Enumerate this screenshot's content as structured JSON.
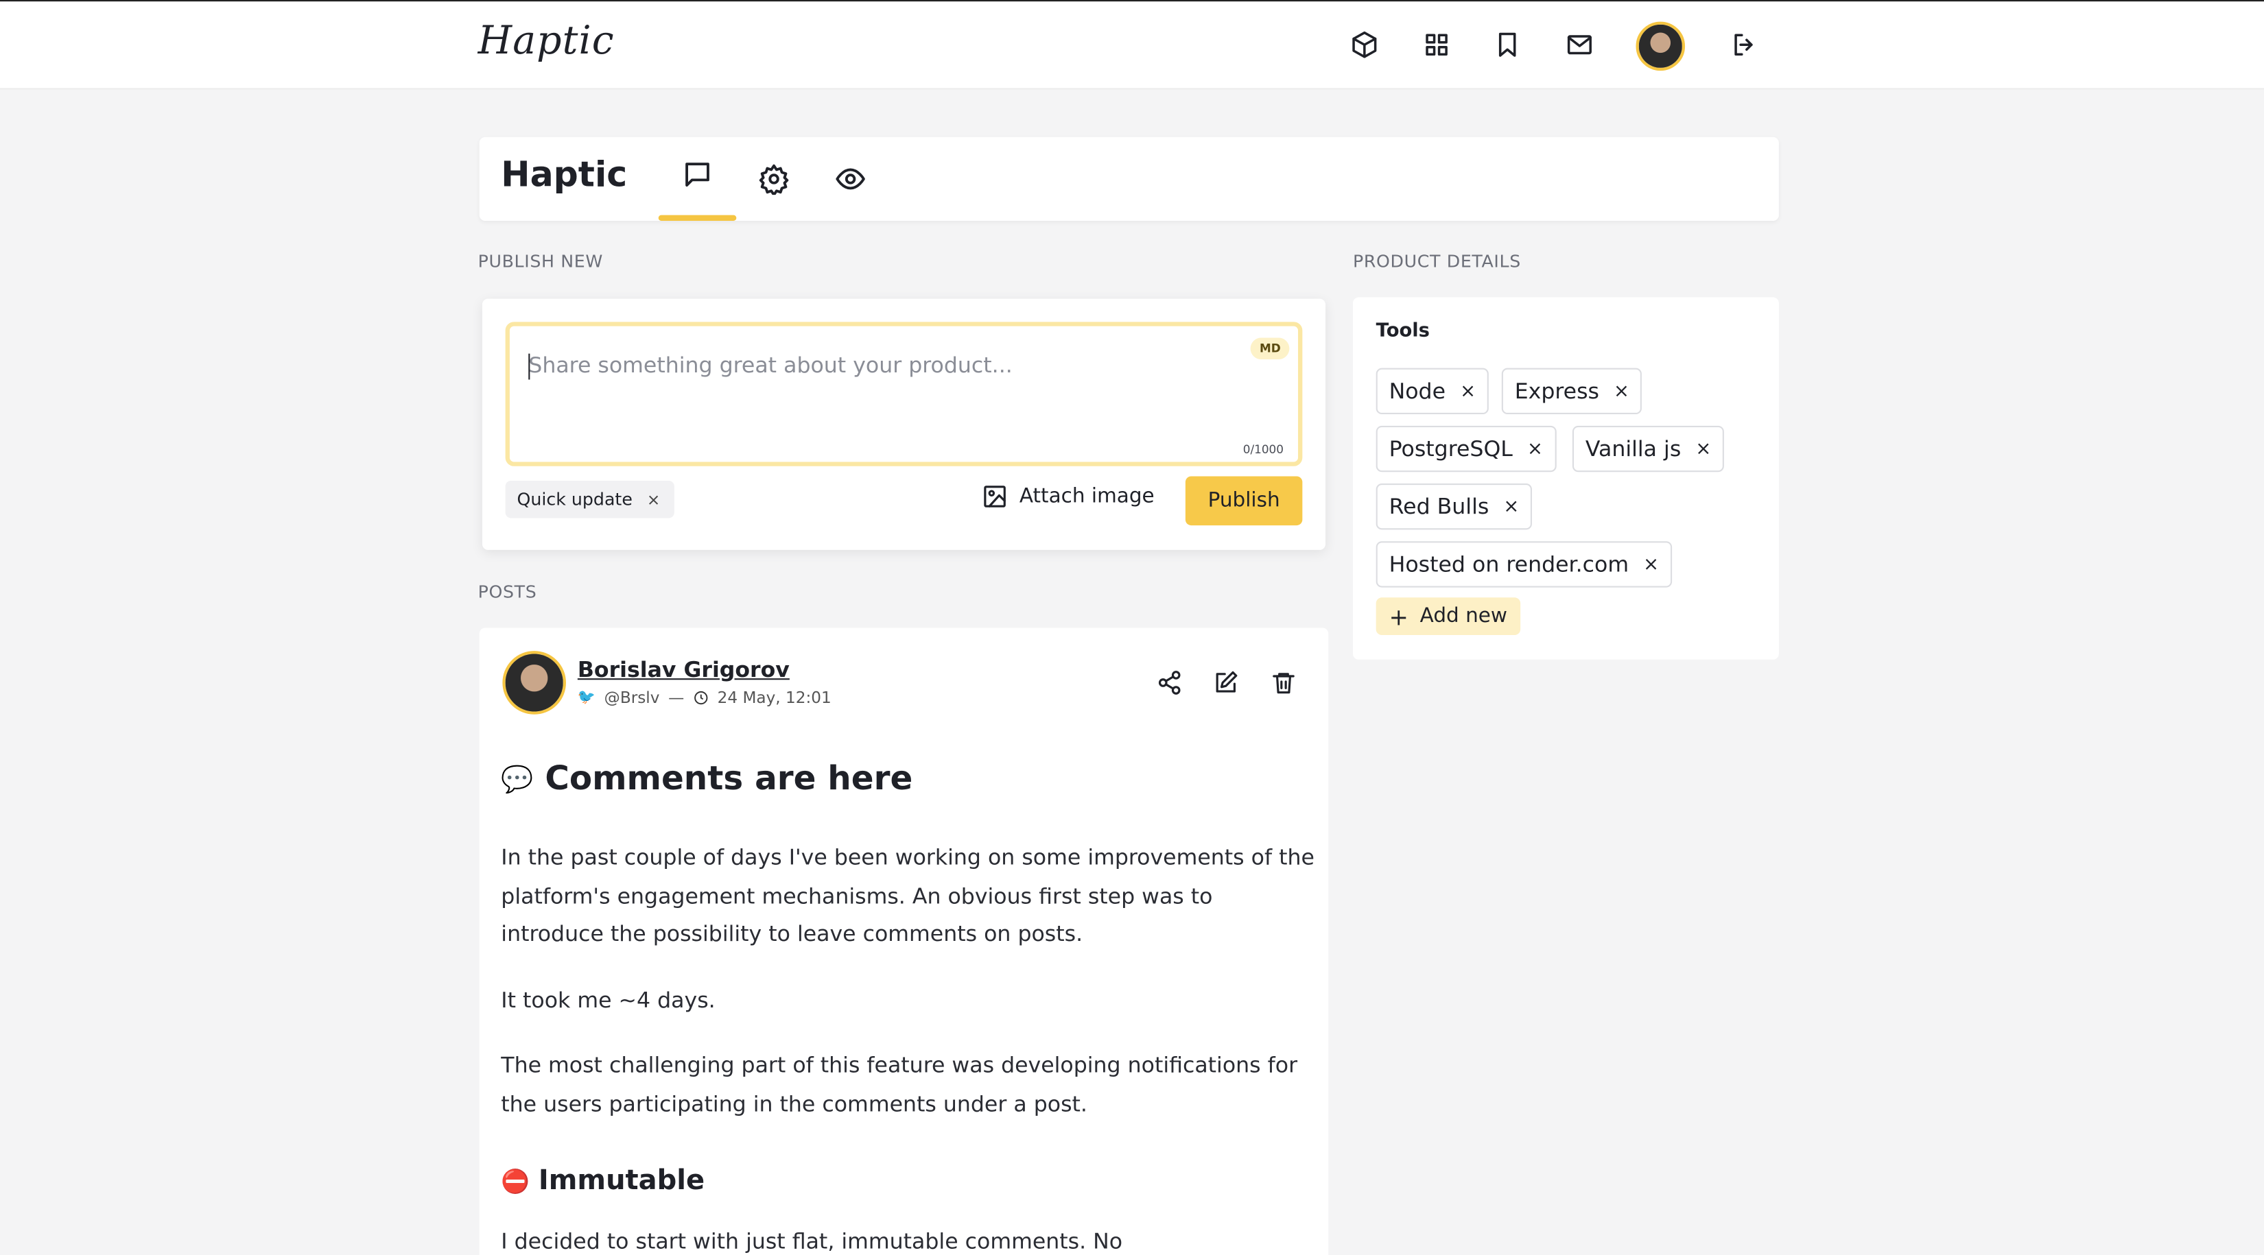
{
  "brand": {
    "logo_text": "Haptic",
    "accent_color": "#f5c542"
  },
  "nav": {
    "icons": [
      "cube-icon",
      "grid-icon",
      "bookmark-icon",
      "mail-icon",
      "avatar",
      "logout-icon"
    ]
  },
  "header": {
    "title": "Haptic",
    "tabs": [
      "comments-tab",
      "settings-tab",
      "preview-tab"
    ]
  },
  "publish": {
    "section_label": "PUBLISH NEW",
    "placeholder": "Share something great about your product...",
    "md_badge": "MD",
    "counter": "0/1000",
    "tag_label": "Quick update",
    "tag_remove": "×",
    "attach_label": "Attach image",
    "publish_label": "Publish"
  },
  "posts": {
    "section_label": "POSTS",
    "items": [
      {
        "author": "Borislav Grigorov",
        "handle": "@Brslv",
        "separator": "—",
        "timestamp": "24 May, 12:01",
        "heading_emoji": "💬",
        "heading": "Comments are here",
        "paragraphs": [
          "In the past couple of days I've been working on some improvements of the platform's engagement mechanisms. An obvious first step was to introduce the possibility to leave comments on posts.",
          "It took me ~4 days.",
          "The most challenging part of this feature was developing notifications for the users participating in the comments under a post."
        ],
        "subheading_emoji": "⛔",
        "subheading": "Immutable",
        "last_paragraph": "I decided to start with just flat, immutable comments. No"
      }
    ]
  },
  "details": {
    "section_label": "PRODUCT DETAILS",
    "tools_title": "Tools",
    "tools": [
      "Node",
      "Express",
      "PostgreSQL",
      "Vanilla js",
      "Red Bulls",
      "Hosted on render.com"
    ],
    "remove_glyph": "×",
    "add_new_label": "Add new",
    "add_glyph": "+"
  }
}
